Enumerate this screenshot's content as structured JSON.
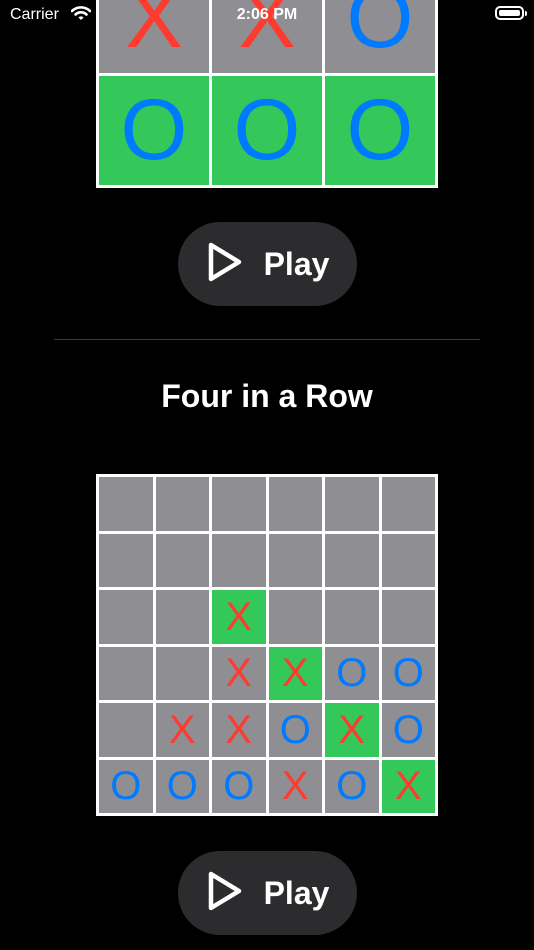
{
  "status_bar": {
    "carrier": "Carrier",
    "time": "2:06 PM"
  },
  "colors": {
    "x_mark": "#ff3b30",
    "o_mark": "#007aff",
    "empty_cell": "#8e8e93",
    "winning_cell": "#34c759",
    "button_bg": "#2c2c2e"
  },
  "tic_tac_toe": {
    "rows": [
      [
        {
          "mark": "X",
          "win": false
        },
        {
          "mark": "X",
          "win": false
        },
        {
          "mark": "O",
          "win": false
        }
      ],
      [
        {
          "mark": "O",
          "win": true
        },
        {
          "mark": "O",
          "win": true
        },
        {
          "mark": "O",
          "win": true
        }
      ]
    ],
    "play_label": "Play",
    "play_icon": "play-icon"
  },
  "four_in_a_row": {
    "title": "Four in a Row",
    "rows": [
      [
        {
          "mark": "",
          "win": false
        },
        {
          "mark": "",
          "win": false
        },
        {
          "mark": "",
          "win": false
        },
        {
          "mark": "",
          "win": false
        },
        {
          "mark": "",
          "win": false
        },
        {
          "mark": "",
          "win": false
        }
      ],
      [
        {
          "mark": "",
          "win": false
        },
        {
          "mark": "",
          "win": false
        },
        {
          "mark": "",
          "win": false
        },
        {
          "mark": "",
          "win": false
        },
        {
          "mark": "",
          "win": false
        },
        {
          "mark": "",
          "win": false
        }
      ],
      [
        {
          "mark": "",
          "win": false
        },
        {
          "mark": "",
          "win": false
        },
        {
          "mark": "X",
          "win": true
        },
        {
          "mark": "",
          "win": false
        },
        {
          "mark": "",
          "win": false
        },
        {
          "mark": "",
          "win": false
        }
      ],
      [
        {
          "mark": "",
          "win": false
        },
        {
          "mark": "",
          "win": false
        },
        {
          "mark": "X",
          "win": false
        },
        {
          "mark": "X",
          "win": true
        },
        {
          "mark": "O",
          "win": false
        },
        {
          "mark": "O",
          "win": false
        }
      ],
      [
        {
          "mark": "",
          "win": false
        },
        {
          "mark": "X",
          "win": false
        },
        {
          "mark": "X",
          "win": false
        },
        {
          "mark": "O",
          "win": false
        },
        {
          "mark": "X",
          "win": true
        },
        {
          "mark": "O",
          "win": false
        }
      ],
      [
        {
          "mark": "O",
          "win": false
        },
        {
          "mark": "O",
          "win": false
        },
        {
          "mark": "O",
          "win": false
        },
        {
          "mark": "X",
          "win": false
        },
        {
          "mark": "O",
          "win": false
        },
        {
          "mark": "X",
          "win": true
        }
      ]
    ],
    "play_label": "Play",
    "play_icon": "play-icon"
  }
}
